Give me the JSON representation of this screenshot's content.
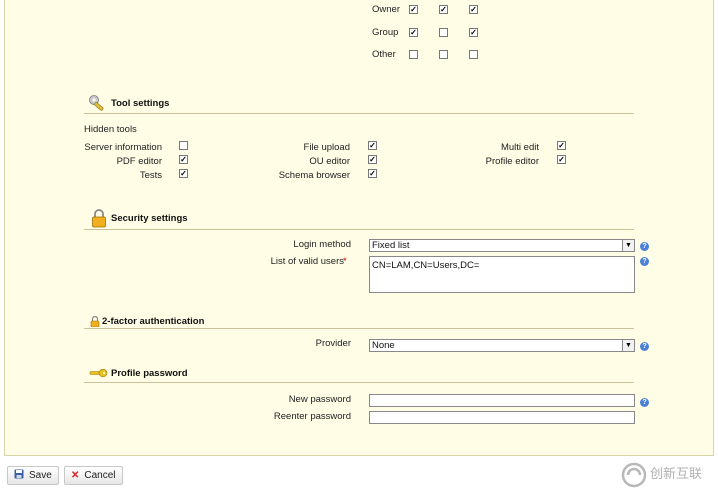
{
  "permissions": {
    "rows": [
      {
        "label": "Owner",
        "checks": [
          true,
          true,
          true
        ]
      },
      {
        "label": "Group",
        "checks": [
          true,
          false,
          true
        ]
      },
      {
        "label": "Other",
        "checks": [
          false,
          false,
          false
        ]
      }
    ]
  },
  "tool_settings": {
    "title": "Tool settings",
    "hidden_tools_label": "Hidden tools",
    "tools": {
      "server_information": {
        "label": "Server information",
        "checked": false
      },
      "pdf_editor": {
        "label": "PDF editor",
        "checked": true
      },
      "tests": {
        "label": "Tests",
        "checked": true
      },
      "file_upload": {
        "label": "File upload",
        "checked": true
      },
      "ou_editor": {
        "label": "OU editor",
        "checked": true
      },
      "schema_browser": {
        "label": "Schema browser",
        "checked": true
      },
      "multi_edit": {
        "label": "Multi edit",
        "checked": true
      },
      "profile_editor": {
        "label": "Profile editor",
        "checked": true
      }
    }
  },
  "security_settings": {
    "title": "Security settings",
    "login_method_label": "Login method",
    "login_method_value": "Fixed list",
    "valid_users_label": "List of valid users",
    "required_mark": "*",
    "valid_users_value": "CN=LAM,CN=Users,DC="
  },
  "two_factor": {
    "title": "2-factor authentication",
    "provider_label": "Provider",
    "provider_value": "None"
  },
  "profile_password": {
    "title": "Profile password",
    "new_password_label": "New password",
    "reenter_password_label": "Reenter password"
  },
  "buttons": {
    "save": "Save",
    "cancel": "Cancel"
  },
  "watermark": {
    "text": "创新互联"
  },
  "colors": {
    "panel_bg": "#fffde6",
    "help_blue": "#4a80d8",
    "cancel_red": "#d02020",
    "required_red": "#cc0000"
  }
}
